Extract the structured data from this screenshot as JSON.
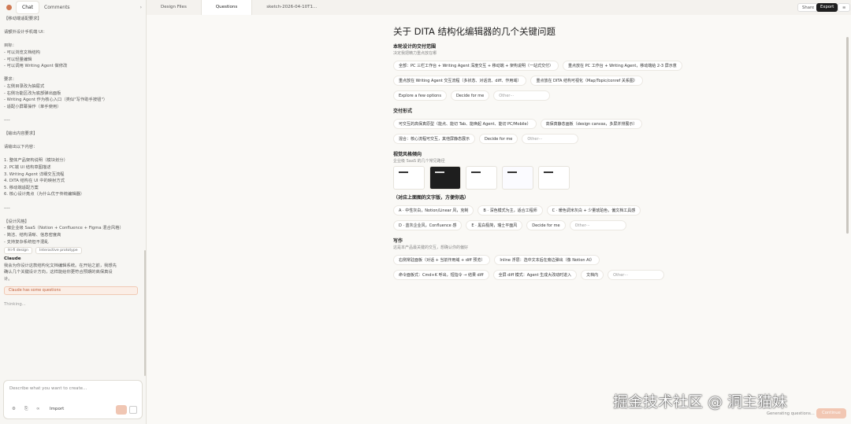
{
  "tabs": {
    "chat": "Chat",
    "comments": "Comments"
  },
  "doc_tabs": [
    "Design Files",
    "Questions",
    "sketch-2026-04-10T1…"
  ],
  "actions": {
    "share": "Share",
    "export": "Export",
    "menu": "≡"
  },
  "chat_lines": [
    "【移动端适配要求】",
    "",
    "请额外设计手机端 UI：",
    "",
    "目标：",
    "- 可以浏览文档结构",
    "- 可以轻量编辑",
    "- 可以调用 Writing Agent 做修改",
    "",
    "要求：",
    "- 左侧目录改为抽屉式",
    "- 右侧功能区改为底部弹出面板",
    "- Writing Agent 作为核心入口（类似\"写作助手按钮\"）",
    "- 适配小屏幕操作（单手使用）",
    "",
    "----",
    "",
    "【输出内容要求】",
    "",
    "请输出以下内容：",
    "",
    "1. 整体产品架构说明（模块划分）",
    "2. PC端 UI 结构草图描述",
    "3. Writing Agent 详细交互流程",
    "4. DITA 结构在 UI 中的映射方式",
    "5. 移动端适配方案",
    "6. 核心设计亮点（为什么优于传统编辑器）",
    "",
    "----",
    "",
    "【设计风格】",
    "- 偏企业级 SaaS（Notion + Confluence + Figma 混合风格）",
    "- 简洁、结构清晰、信息密度高",
    "- 支持复杂系统但不混乱"
  ],
  "chips": [
    "Hi-fi design",
    "Interactive prototype"
  ],
  "claude_name": "Claude",
  "claude_msg": [
    "我会为你设计这款结构化文档编辑系统。在开始之前，我想先",
    "确认几个关键设计方向，这样能给你更符合预期的高保真设",
    "计。"
  ],
  "notice": "Claude has some questions",
  "thinking": "Thinking...",
  "input_placeholder": "Describe what you want to create...",
  "input_import": "Import",
  "page_title": "关于 DITA 结构化编辑器的几个关键问题",
  "sections": [
    {
      "title": "本轮设计的交付范围",
      "subtitle": "决定我把精力重点放在哪",
      "options": [
        "全部：PC 三栏工作台 + Writing Agent 深度交互 + 移动端 + 架构说明（一站式交付）",
        "重点放在 PC 工作台 + Writing Agent，移动端给 2-3 屏示意",
        "重点放在 Writing Agent 交互流程（多状态、对话流、diff、作用域）",
        "重点放在 DITA 结构可视化（Map/Topic/conref 关系图）",
        "Explore a few options",
        "Decide for me"
      ],
      "other": "Other···"
    },
    {
      "title": "交付形式",
      "subtitle": "",
      "options": [
        "可交互的高保真原型（能点、能切 Tab、能唤起 Agent、能切 PC/Mobile）",
        "高保真静态画板（design canvas，多屏并排展示）",
        "混合：核心流程可交互，其他屏静态展示",
        "Decide for me"
      ],
      "other": "Other···"
    },
    {
      "title": "视觉风格倾向",
      "subtitle": "企业级 SaaS 的几个常见路径",
      "thumbs": 5
    },
    {
      "title": "（对应上面图的文字版，方便你选）",
      "subtitle": "",
      "options": [
        "A · 中性灰白，Notion/Linear 风，克制",
        "B · 深色模式为主，适合工程师",
        "C · 暖色调米灰白 + 少量琥珀色，偏文档工具感",
        "D · 蓝灰企业风，Confluence 感",
        "E · 黑白极简，瑞士平面风",
        "Decide for me"
      ],
      "other": "Other···"
    },
    {
      "title": "写作",
      "subtitle": "这是本产品最关键的交互，想确认你的偏好",
      "options": [
        "右侧常驻面板（对话 + 当前作用域 + diff 预览）",
        "Inline 浮层：选中文本后在旁边弹出（像 Notion AI）",
        "命令面板式：Cmd+K 呼出，短指令 → 结果 diff",
        "全屏 diff 模式：Agent 生成大改动时进入",
        "文档内"
      ],
      "other": "Other···"
    }
  ],
  "watermark": "掘金技术社区 @ 洞主猫妹",
  "generating": "Generating questions...",
  "continue": "Continue"
}
